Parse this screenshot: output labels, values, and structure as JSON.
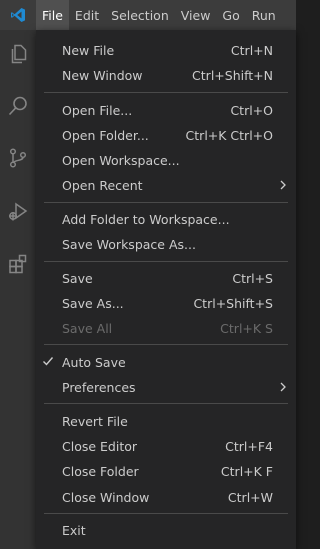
{
  "menubar": {
    "items": [
      "File",
      "Edit",
      "Selection",
      "View",
      "Go",
      "Run"
    ]
  },
  "activity_bar": {
    "icons": [
      "explorer-icon",
      "search-icon",
      "source-control-icon",
      "run-debug-icon",
      "extensions-icon"
    ]
  },
  "file_menu": {
    "new_file": {
      "label": "New File",
      "shortcut": "Ctrl+N"
    },
    "new_window": {
      "label": "New Window",
      "shortcut": "Ctrl+Shift+N"
    },
    "open_file": {
      "label": "Open File...",
      "shortcut": "Ctrl+O"
    },
    "open_folder": {
      "label": "Open Folder...",
      "shortcut": "Ctrl+K Ctrl+O"
    },
    "open_workspace": {
      "label": "Open Workspace..."
    },
    "open_recent": {
      "label": "Open Recent"
    },
    "add_folder": {
      "label": "Add Folder to Workspace..."
    },
    "save_workspace_as": {
      "label": "Save Workspace As..."
    },
    "save": {
      "label": "Save",
      "shortcut": "Ctrl+S"
    },
    "save_as": {
      "label": "Save As...",
      "shortcut": "Ctrl+Shift+S"
    },
    "save_all": {
      "label": "Save All",
      "shortcut": "Ctrl+K S",
      "enabled": false
    },
    "auto_save": {
      "label": "Auto Save",
      "checked": true
    },
    "preferences": {
      "label": "Preferences"
    },
    "revert_file": {
      "label": "Revert File"
    },
    "close_editor": {
      "label": "Close Editor",
      "shortcut": "Ctrl+F4"
    },
    "close_folder": {
      "label": "Close Folder",
      "shortcut": "Ctrl+K F"
    },
    "close_window": {
      "label": "Close Window",
      "shortcut": "Ctrl+W"
    },
    "exit": {
      "label": "Exit"
    }
  },
  "colors": {
    "titlebar": "#3c3c3c",
    "activity_bar": "#333333",
    "menu_bg": "#252526",
    "accent": "#1f8ad2",
    "text": "#cccccc",
    "disabled_text": "#6b6b6b"
  }
}
